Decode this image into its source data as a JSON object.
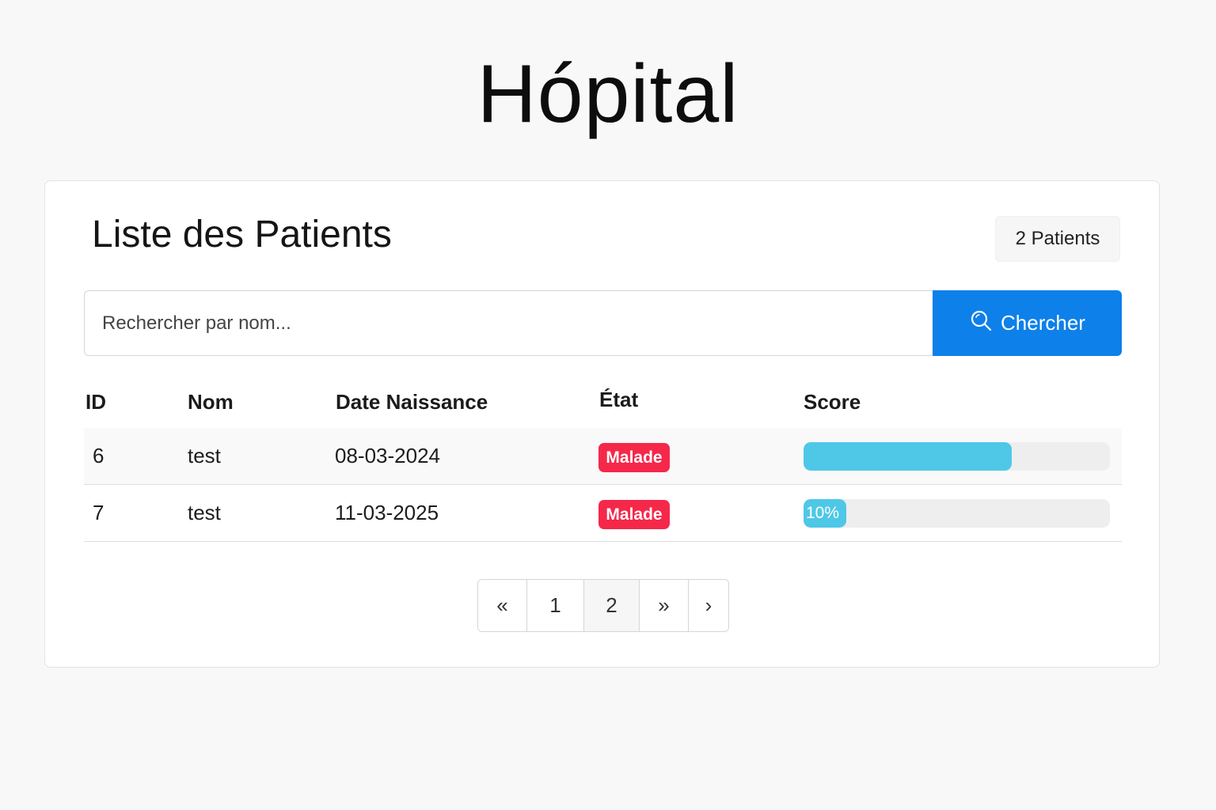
{
  "app": {
    "title": "Hópital"
  },
  "card": {
    "title": "Liste des Patients",
    "count_label": "2 Patients"
  },
  "search": {
    "placeholder": "Rechercher par nom...",
    "value": "",
    "button_label": "Chercher",
    "button_icon": "search-icon"
  },
  "table": {
    "headers": [
      "ID",
      "Nom",
      "Date Naissance",
      "État",
      "Score"
    ],
    "rows": [
      {
        "id": "6",
        "nom": "test",
        "date": "08-03-2024",
        "etat": "Malade",
        "score": 0.68,
        "score_label": ""
      },
      {
        "id": "7",
        "nom": "test",
        "date": "11-03-2025",
        "etat": "Malade",
        "score": 0.1,
        "score_label": "10%"
      }
    ]
  },
  "pagination": {
    "items": [
      {
        "label": "«",
        "active": false
      },
      {
        "label": "1",
        "active": false
      },
      {
        "label": "2",
        "active": true
      },
      {
        "label": "»",
        "active": false
      },
      {
        "label": "›",
        "active": false
      }
    ]
  },
  "colors": {
    "primary": "#0d80ea",
    "danger": "#f5284a",
    "progress": "#4ec8e6",
    "background": "#f8f8f8"
  }
}
